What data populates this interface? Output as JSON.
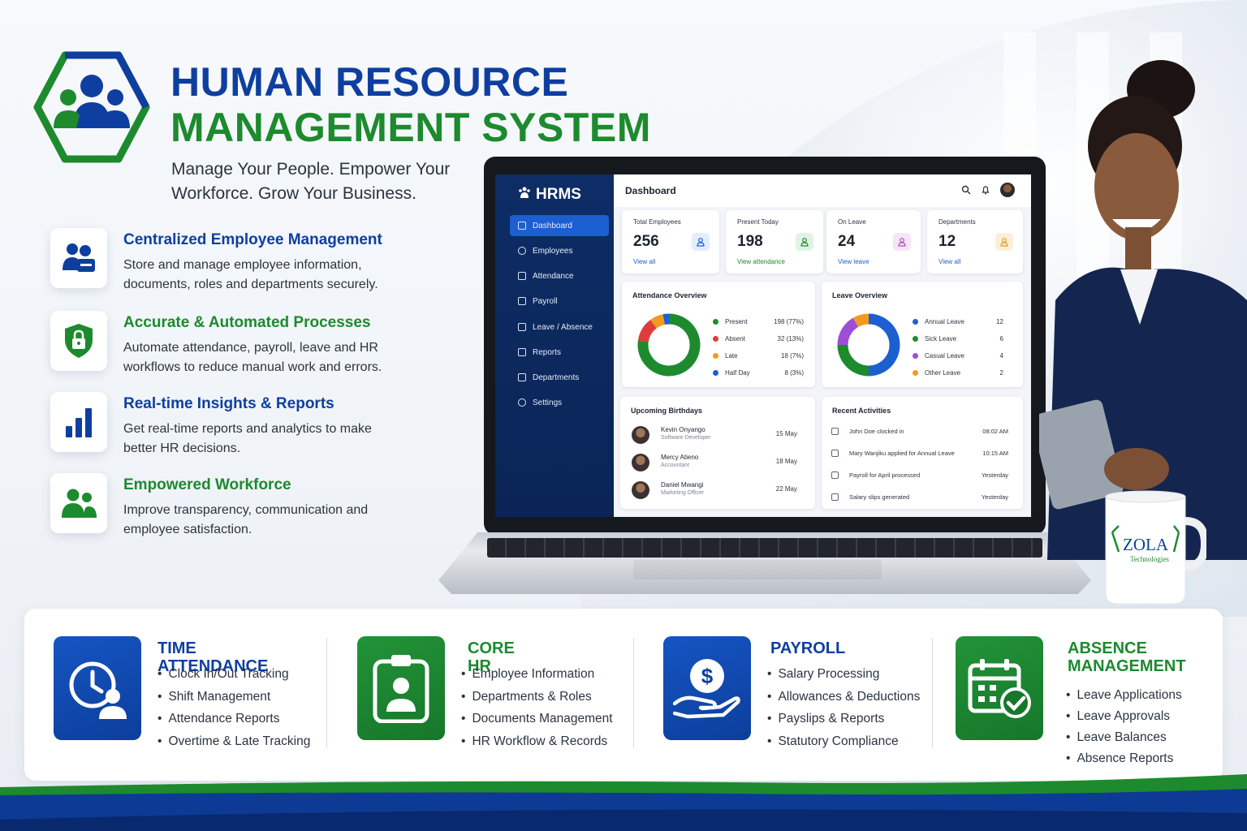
{
  "header": {
    "title_line1": "HUMAN RESOURCE",
    "title_line2": "MANAGEMENT SYSTEM",
    "tagline": "Manage Your People. Empower Your Workforce. Grow Your Business."
  },
  "features": [
    {
      "title": "Centralized Employee Management",
      "desc": "Store and manage employee information, documents, roles and departments securely.",
      "icon": "users-id-icon"
    },
    {
      "title": "Accurate & Automated Processes",
      "desc": "Automate attendance, payroll, leave and HR workflows to reduce manual work and errors.",
      "icon": "shield-lock-icon"
    },
    {
      "title": "Real-time Insights & Reports",
      "desc": "Get real-time reports and analytics to make better HR decisions.",
      "icon": "bar-chart-icon"
    },
    {
      "title": "Empowered Workforce",
      "desc": "Improve transparency, communication and employee satisfaction.",
      "icon": "team-icon"
    }
  ],
  "app": {
    "brand": "HRMS",
    "page_title": "Dashboard",
    "nav": [
      {
        "label": "Dashboard",
        "icon": "grid-icon"
      },
      {
        "label": "Employees",
        "icon": "user-icon"
      },
      {
        "label": "Attendance",
        "icon": "clock-icon"
      },
      {
        "label": "Payroll",
        "icon": "wallet-icon"
      },
      {
        "label": "Leave / Absence",
        "icon": "calendar-icon"
      },
      {
        "label": "Reports",
        "icon": "report-icon"
      },
      {
        "label": "Departments",
        "icon": "building-icon"
      },
      {
        "label": "Settings",
        "icon": "gear-icon"
      }
    ],
    "stats": [
      {
        "label": "Total Employees",
        "value": "256",
        "link": "View all",
        "color": "#1c5fd1",
        "bg": "#e3edfb"
      },
      {
        "label": "Present Today",
        "value": "198",
        "link": "View attendance",
        "color": "#1d8a2e",
        "bg": "#e2f3e4"
      },
      {
        "label": "On Leave",
        "value": "24",
        "link": "View leave",
        "color": "#b34db8",
        "bg": "#f6e5f7"
      },
      {
        "label": "Departments",
        "value": "12",
        "link": "View all",
        "color": "#e39b20",
        "bg": "#fcefd9"
      }
    ],
    "attendance": {
      "title": "Attendance Overview",
      "items": [
        {
          "name": "Present",
          "value": 198,
          "display": "198 (77%)",
          "color": "#1d8a2e"
        },
        {
          "name": "Absent",
          "value": 32,
          "display": "32 (13%)",
          "color": "#e03b3b"
        },
        {
          "name": "Late",
          "value": 18,
          "display": "18 (7%)",
          "color": "#f29a1e"
        },
        {
          "name": "Half Day",
          "value": 8,
          "display": "8 (3%)",
          "color": "#1c5fd1"
        }
      ]
    },
    "leave": {
      "title": "Leave Overview",
      "items": [
        {
          "name": "Annual Leave",
          "value": 12,
          "display": "12",
          "color": "#1c5fd1"
        },
        {
          "name": "Sick Leave",
          "value": 6,
          "display": "6",
          "color": "#1d8a2e"
        },
        {
          "name": "Casual Leave",
          "value": 4,
          "display": "4",
          "color": "#9c4fd6"
        },
        {
          "name": "Other Leave",
          "value": 2,
          "display": "2",
          "color": "#f29a1e"
        }
      ]
    },
    "birthdays": {
      "title": "Upcoming Birthdays",
      "items": [
        {
          "name": "Kevin Onyango",
          "role": "Software Developer",
          "date": "15 May"
        },
        {
          "name": "Mercy Atieno",
          "role": "Accountant",
          "date": "18 May"
        },
        {
          "name": "Daniel Mwangi",
          "role": "Marketing Officer",
          "date": "22 May"
        }
      ]
    },
    "activities": {
      "title": "Recent Activities",
      "items": [
        {
          "text": "John Doe clocked in",
          "time": "08:02 AM"
        },
        {
          "text": "Mary Wanjiku applied for Annual Leave",
          "time": "10:15 AM"
        },
        {
          "text": "Payroll for April processed",
          "time": "Yesterday"
        },
        {
          "text": "Salary slips generated",
          "time": "Yesterday"
        }
      ]
    }
  },
  "mug": {
    "brand": "ZOLA",
    "sub": "Technologies"
  },
  "modules": [
    {
      "title": "TIME ATTENDANCE",
      "icon": "clock-user-icon",
      "color": "blue",
      "items": [
        "Clock In/Out Tracking",
        "Shift Management",
        "Attendance Reports",
        "Overtime & Late Tracking"
      ]
    },
    {
      "title": "CORE HR",
      "icon": "id-badge-icon",
      "color": "green",
      "items": [
        "Employee Information",
        "Departments & Roles",
        "Documents Management",
        "HR Workflow & Records"
      ]
    },
    {
      "title": "PAYROLL",
      "icon": "hand-dollar-icon",
      "color": "blue",
      "items": [
        "Salary Processing",
        "Allowances & Deductions",
        "Payslips & Reports",
        "Statutory Compliance"
      ]
    },
    {
      "title": "ABSENCE MANAGEMENT",
      "title_line1": "ABSENCE",
      "title_line2": "MANAGEMENT",
      "icon": "calendar-check-icon",
      "color": "green",
      "items": [
        "Leave Applications",
        "Leave Approvals",
        "Leave Balances",
        "Absence Reports"
      ]
    }
  ],
  "colors": {
    "brand_blue": "#0e3fa0",
    "brand_green": "#1d8a2e",
    "sidebar": "#0e2d66"
  }
}
